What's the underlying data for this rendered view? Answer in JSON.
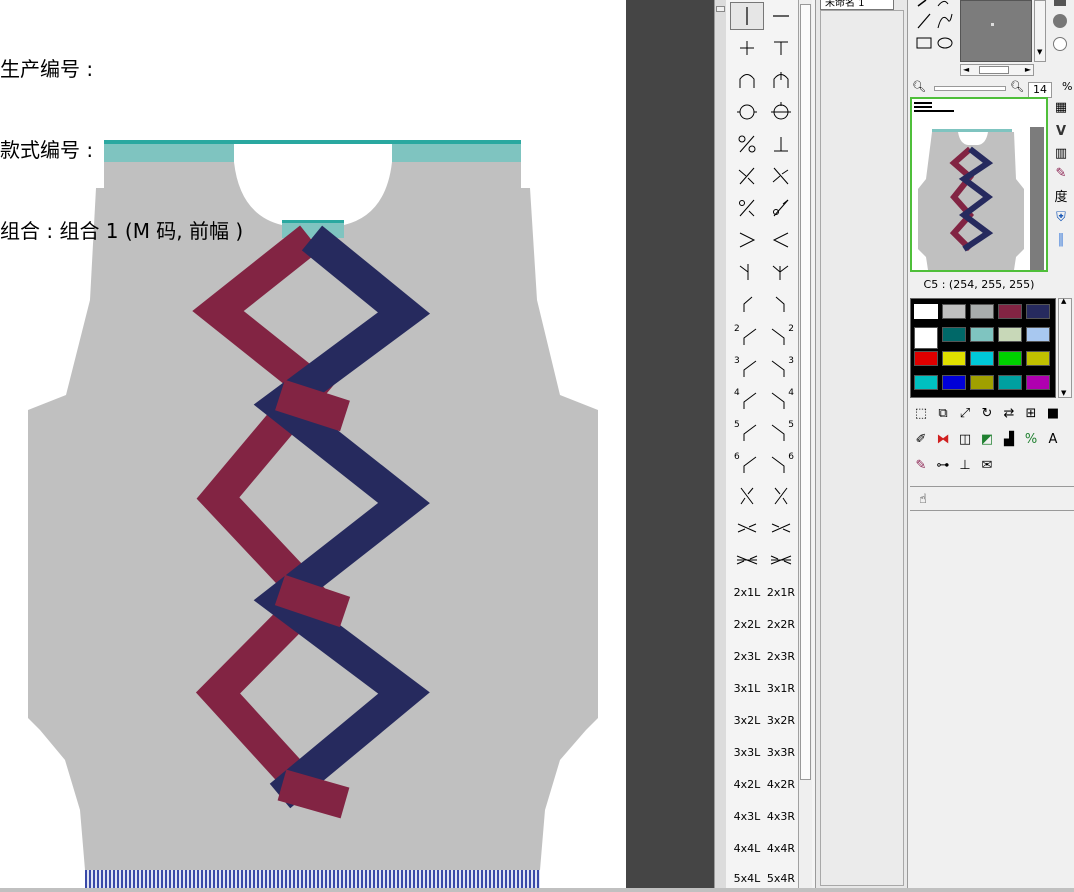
{
  "info": {
    "production_no_label": "生产编号 :",
    "style_no_label": "款式编号 :",
    "combo_label": "组合 : 组合 1 (M 码, 前幅 )"
  },
  "colors": {
    "body_gray": "#c0c0c0",
    "teal": "#7fc4c0",
    "teal_line": "#2aa8a0",
    "burgundy": "#822443",
    "navy": "#262a5e",
    "rib_blue": "#3a4aa8",
    "workspace": "#454545"
  },
  "tools": {
    "text_labels": [
      "2x1L",
      "2x1R",
      "2x2L",
      "2x2R",
      "2x3L",
      "2x3R",
      "3x1L",
      "3x1R",
      "3x2L",
      "3x2R",
      "3x3L",
      "3x3R",
      "4x2L",
      "4x2R",
      "4x3L",
      "4x3R",
      "4x4L",
      "4x4R",
      "5x4L",
      "5x4R"
    ],
    "numbered_marks": [
      "2",
      "2",
      "3",
      "3",
      "4",
      "4",
      "5",
      "5",
      "6",
      "6"
    ]
  },
  "mid_panel": {
    "tab_label": "未命名 1"
  },
  "right_panel": {
    "zoom_value": "14",
    "zoom_unit": "%",
    "color_readout": "C5 : (254, 255, 255)",
    "degree_char": "度",
    "palette": [
      [
        "#ffffff",
        "#c0c0c0",
        "#a8acac",
        "#822443",
        "#262a5e"
      ],
      [
        "#ffffff",
        "#006868",
        "#7fc4c0",
        "#c8d8b8",
        "#a8c8f0"
      ],
      [
        "#e00000",
        "#e0e000",
        "#00c8d8",
        "#00d000",
        "#c0c000"
      ],
      [
        "#00c0c0",
        "#0000d8",
        "#a0a000",
        "#00a0a0",
        "#b000b0"
      ]
    ]
  }
}
